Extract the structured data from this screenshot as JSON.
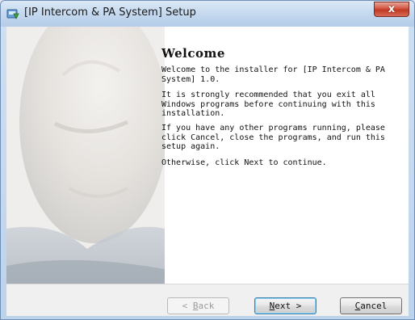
{
  "window": {
    "title": "[IP Intercom & PA System] Setup",
    "close_glyph": "x"
  },
  "page": {
    "heading": "Welcome",
    "paragraphs": [
      "Welcome to the installer for [IP Intercom & PA\nSystem] 1.0.",
      "It is strongly recommended that you exit all\nWindows programs before continuing with this\ninstallation.",
      "If you have any other programs running, please\nclick Cancel, close the programs, and run this\nsetup again.",
      "Otherwise, click Next to continue."
    ]
  },
  "buttons": {
    "back": {
      "before": "< ",
      "mnemonic": "B",
      "after": "ack",
      "enabled": false
    },
    "next": {
      "mnemonic": "N",
      "after": "ext >",
      "enabled": true,
      "default": true
    },
    "cancel": {
      "mnemonic": "C",
      "after": "ancel",
      "enabled": true
    }
  },
  "icons": {
    "app": "installer-icon",
    "close": "close-icon"
  }
}
